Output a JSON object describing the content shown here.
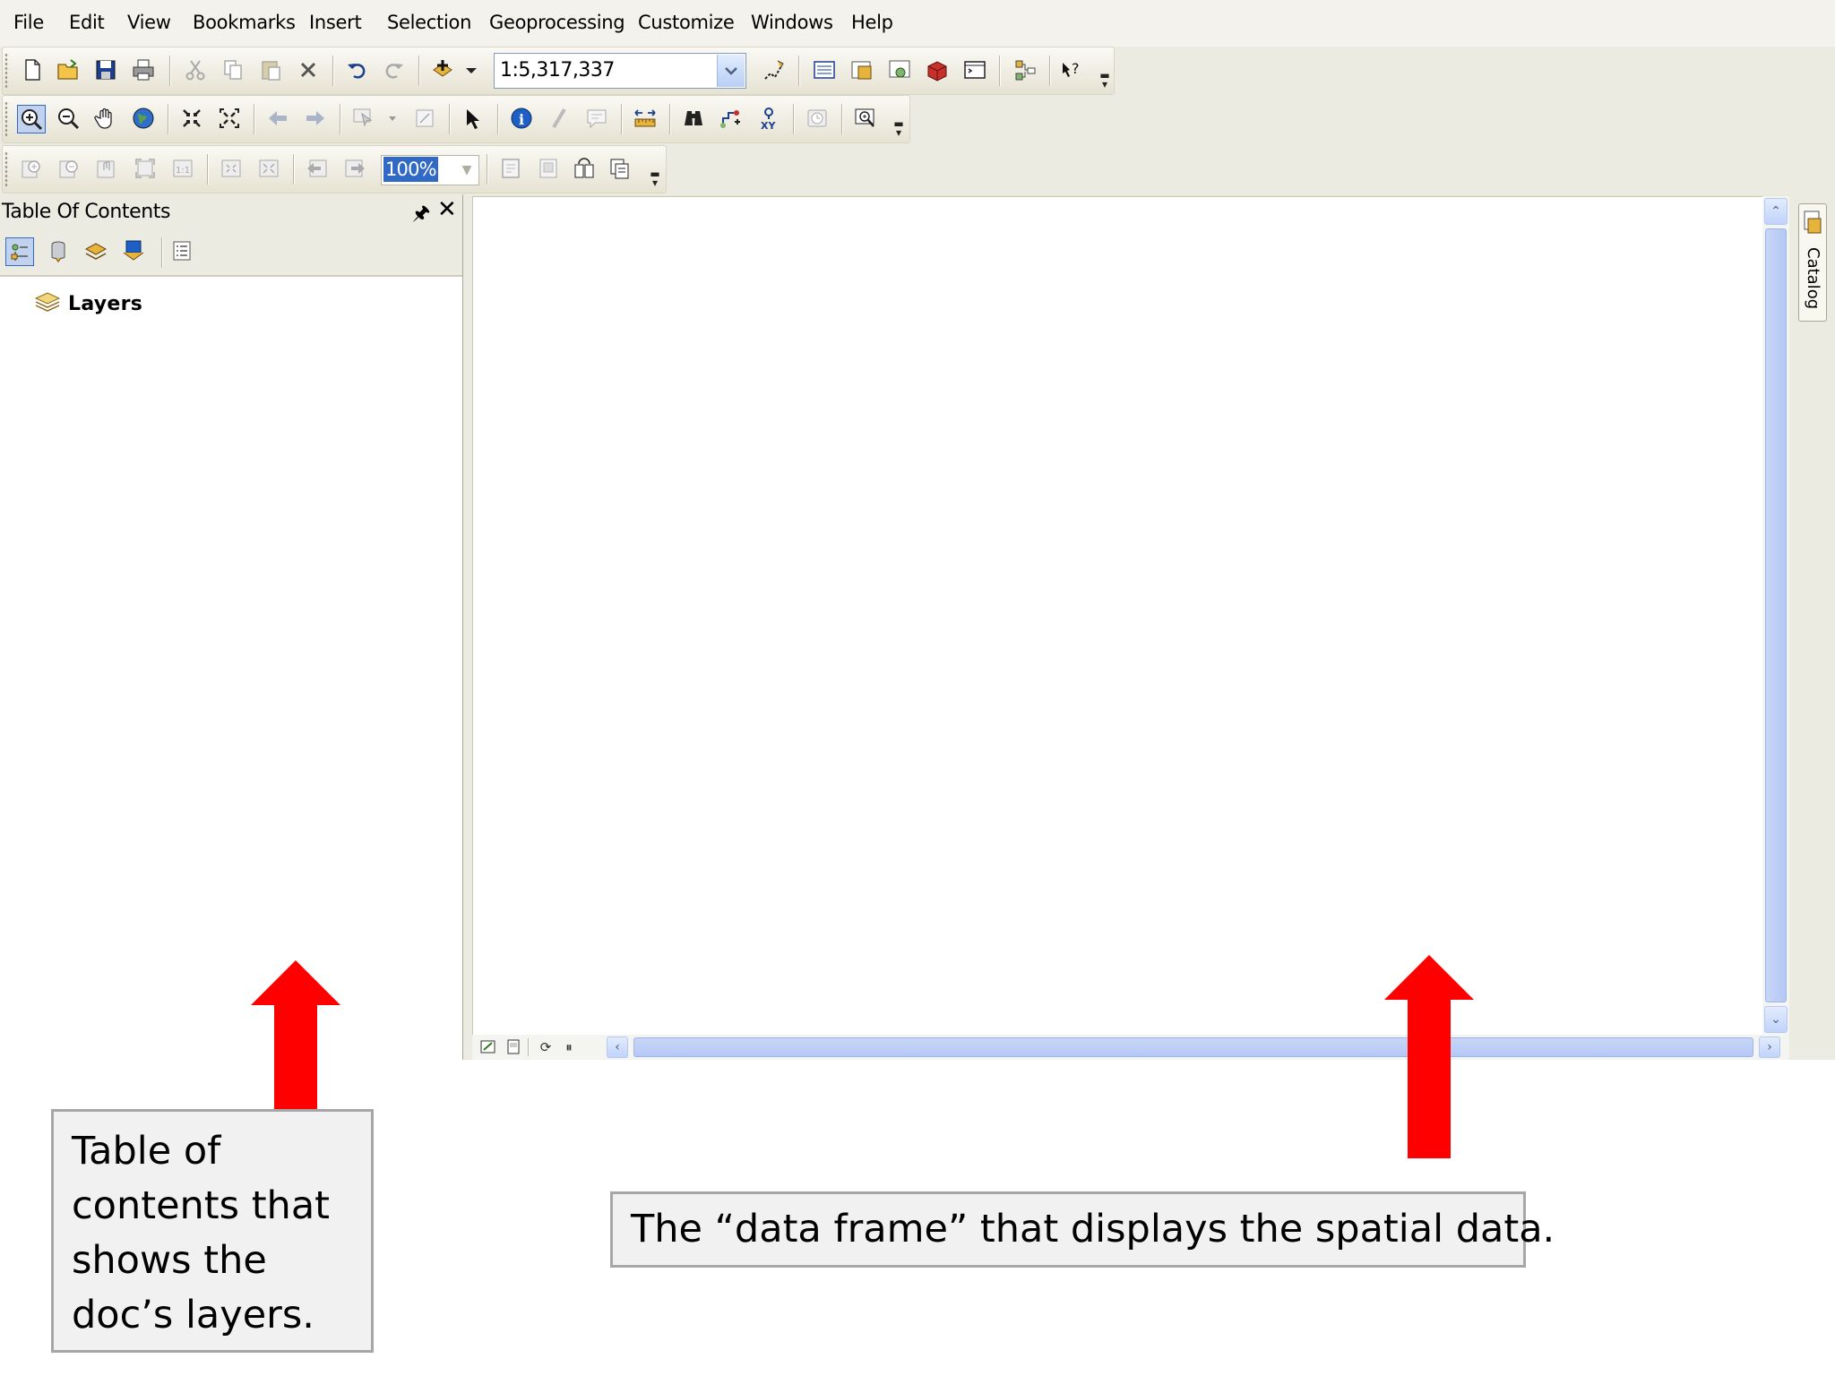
{
  "menubar": {
    "items": [
      "File",
      "Edit",
      "View",
      "Bookmarks",
      "Insert",
      "Selection",
      "Geoprocessing",
      "Customize",
      "Windows",
      "Help"
    ]
  },
  "toolbar": {
    "map_scale": "1:5,317,337",
    "layout_zoom": "100%"
  },
  "toc": {
    "title": "Table Of Contents",
    "root_label": "Layers"
  },
  "side_tab": {
    "label": "Catalog"
  },
  "annotations": {
    "left_callout": "Table of contents that shows the doc’s layers.",
    "right_callout": "The “data frame” that displays the spatial data."
  },
  "colors": {
    "arrow": "#ff0000",
    "selection_highlight": "#316ac5",
    "scrollbar": "#b5c8f5",
    "chrome": "#ece9d8"
  }
}
